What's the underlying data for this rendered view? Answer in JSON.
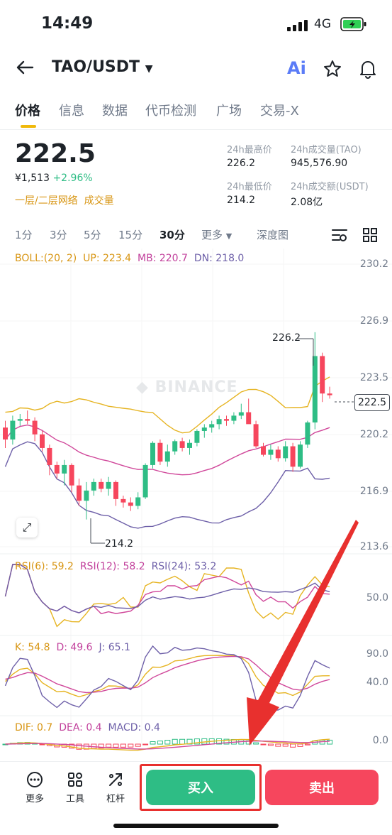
{
  "status_bar": {
    "time": "14:49",
    "network": "4G"
  },
  "header": {
    "pair": "TAO/USDT",
    "ai_label": "Ai"
  },
  "tabs": [
    "价格",
    "信息",
    "数据",
    "代币检测",
    "广场",
    "交易-X"
  ],
  "price": {
    "last": "222.5",
    "fiat": "¥1,513",
    "change": "+2.96%",
    "tag1": "一层/二层网络",
    "tag2": "成交量"
  },
  "stats": {
    "high_label": "24h最高价",
    "high_value": "226.2",
    "vol_tao_label": "24h成交量(TAO)",
    "vol_tao_value": "945,576.90",
    "low_label": "24h最低价",
    "low_value": "214.2",
    "vol_usdt_label": "24h成交额(USDT)",
    "vol_usdt_value": "2.08亿"
  },
  "intervals": [
    "1分",
    "3分",
    "5分",
    "15分",
    "30分",
    "更多",
    "深度图"
  ],
  "indicators": {
    "boll_name": "BOLL:(20, 2)",
    "boll_up": "UP: 223.4",
    "boll_mb": "MB: 220.7",
    "boll_dn": "DN: 218.0",
    "rsi6": "RSI(6): 59.2",
    "rsi12": "RSI(12): 58.2",
    "rsi24": "RSI(24): 53.2",
    "k": "K: 54.8",
    "d": "D: 49.6",
    "j": "J: 65.1",
    "dif": "DIF: 0.7",
    "dea": "DEA: 0.4",
    "macd": "MACD: 0.4"
  },
  "axis": {
    "price": [
      "230.2",
      "226.9",
      "223.5",
      "220.2",
      "216.9",
      "213.6"
    ],
    "rsi": "50.0",
    "kdj_high": "90.0",
    "kdj_low": "40.0",
    "macd": "0.0"
  },
  "markers": {
    "high": "226.2",
    "low": "214.2",
    "current": "222.5"
  },
  "watermark": "BINANCE",
  "toolbar": {
    "more": "更多",
    "tools": "工具",
    "leverage": "杠杆",
    "buy": "买入",
    "sell": "卖出"
  },
  "colors": {
    "up": "#2ebd85",
    "down": "#f6465d",
    "accent": "#f0b90b",
    "annotation": "#e8302e"
  },
  "chart_data": {
    "type": "candlestick",
    "interval": "30分",
    "candles": [
      [
        220.6,
        221.0,
        219.4,
        219.9
      ],
      [
        219.9,
        221.3,
        219.6,
        221.0
      ],
      [
        221.0,
        221.4,
        220.7,
        221.1
      ],
      [
        221.1,
        221.6,
        220.8,
        221.0
      ],
      [
        221.0,
        221.2,
        219.8,
        220.2
      ],
      [
        220.2,
        220.4,
        219.2,
        219.4
      ],
      [
        219.4,
        219.6,
        217.8,
        218.4
      ],
      [
        218.4,
        218.6,
        217.6,
        217.9
      ],
      [
        217.9,
        218.7,
        217.2,
        218.4
      ],
      [
        218.4,
        218.5,
        216.8,
        217.2
      ],
      [
        217.2,
        217.6,
        216.0,
        216.3
      ],
      [
        216.3,
        217.4,
        215.2,
        216.9
      ],
      [
        216.9,
        217.6,
        216.6,
        217.4
      ],
      [
        217.4,
        217.6,
        216.8,
        217.0
      ],
      [
        217.0,
        217.7,
        216.6,
        217.4
      ],
      [
        217.4,
        217.5,
        216.0,
        216.4
      ],
      [
        216.4,
        216.6,
        215.9,
        216.2
      ],
      [
        216.2,
        216.5,
        215.7,
        216.0
      ],
      [
        216.0,
        216.8,
        215.8,
        216.5
      ],
      [
        216.5,
        218.5,
        216.4,
        218.4
      ],
      [
        218.4,
        219.8,
        218.2,
        219.7
      ],
      [
        219.7,
        219.9,
        218.4,
        218.6
      ],
      [
        218.6,
        219.6,
        218.3,
        219.2
      ],
      [
        219.2,
        219.9,
        219.0,
        219.8
      ],
      [
        219.8,
        220.0,
        219.2,
        219.4
      ],
      [
        219.4,
        219.9,
        219.0,
        219.7
      ],
      [
        219.7,
        220.5,
        219.5,
        220.4
      ],
      [
        220.4,
        220.8,
        220.0,
        220.6
      ],
      [
        220.6,
        221.0,
        220.3,
        220.8
      ],
      [
        220.8,
        221.3,
        220.5,
        221.1
      ],
      [
        221.1,
        221.3,
        220.7,
        221.0
      ],
      [
        221.0,
        221.5,
        220.8,
        221.3
      ],
      [
        221.3,
        222.0,
        221.1,
        221.5
      ],
      [
        221.5,
        222.3,
        220.9,
        220.8
      ],
      [
        220.8,
        221.0,
        219.4,
        219.5
      ],
      [
        219.5,
        219.7,
        218.9,
        219.0
      ],
      [
        219.0,
        219.6,
        218.7,
        219.3
      ],
      [
        219.3,
        219.5,
        218.6,
        218.8
      ],
      [
        218.8,
        219.8,
        218.6,
        219.5
      ],
      [
        219.5,
        219.7,
        218.0,
        218.3
      ],
      [
        218.3,
        219.8,
        218.2,
        219.6
      ],
      [
        219.6,
        221.0,
        219.4,
        220.9
      ],
      [
        220.9,
        226.2,
        220.5,
        224.8
      ],
      [
        224.8,
        225.0,
        222.1,
        222.6
      ],
      [
        222.6,
        223.0,
        222.3,
        222.5
      ]
    ],
    "y_range": [
      213.6,
      230.2
    ],
    "high_marker": 226.2,
    "low_marker": 214.2,
    "current": 222.5
  }
}
